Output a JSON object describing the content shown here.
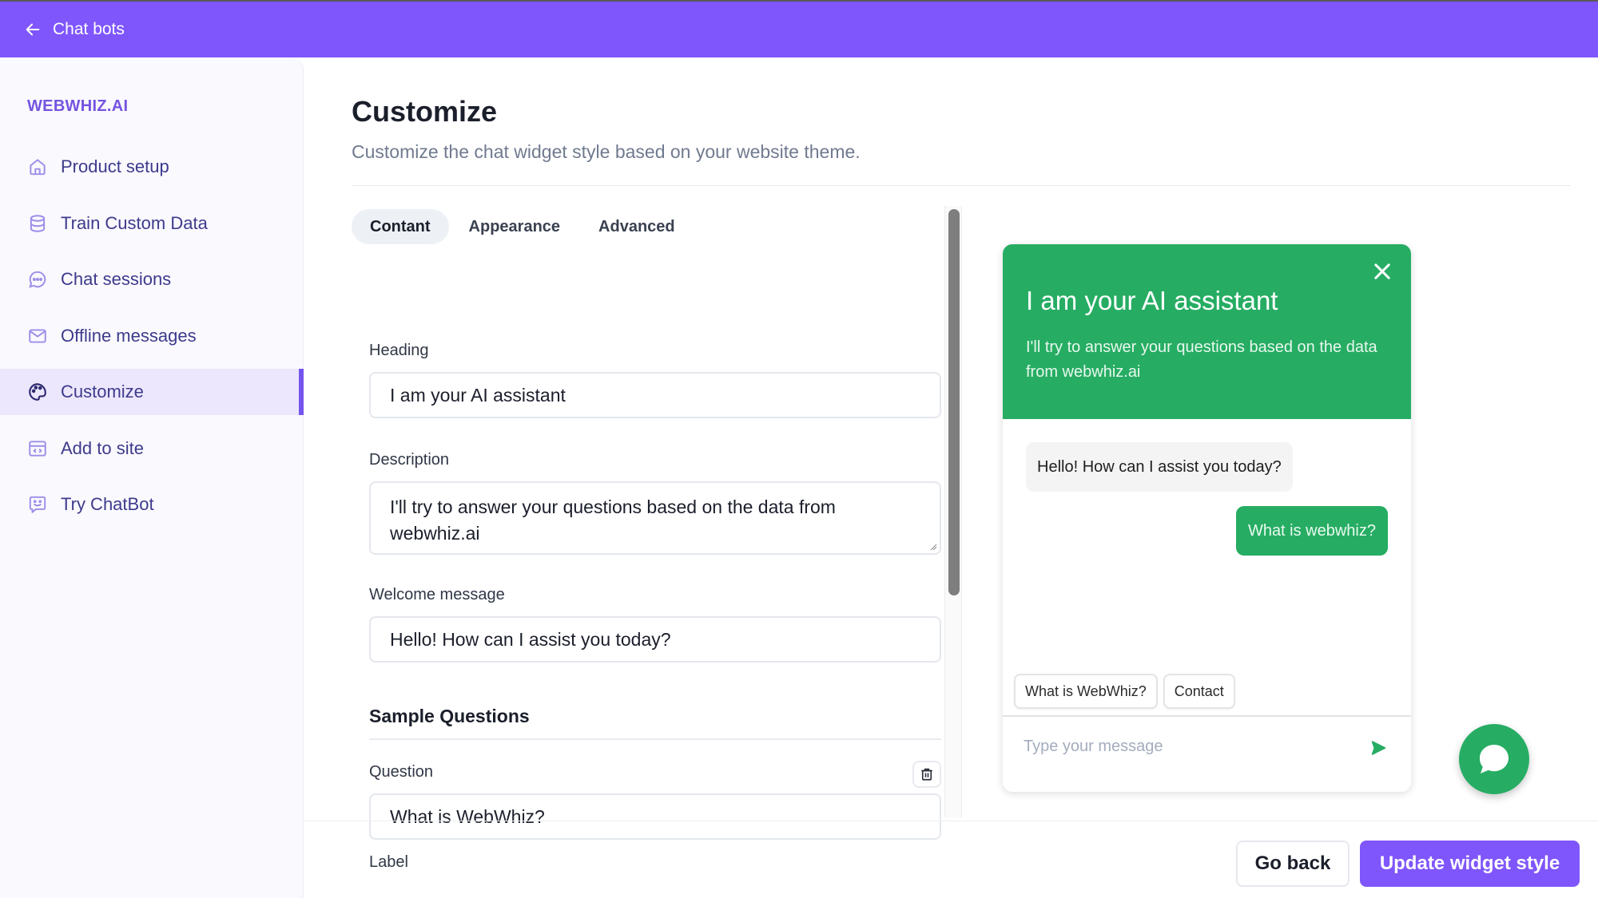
{
  "topbar": {
    "back_label": "Chat bots",
    "back_icon": "arrow-left-icon",
    "color": "#7f56fb"
  },
  "sidebar": {
    "brand": "WEBWHIZ.AI",
    "items": [
      {
        "label": "Product setup",
        "icon": "home-icon",
        "active": false
      },
      {
        "label": "Train Custom Data",
        "icon": "database-icon",
        "active": false
      },
      {
        "label": "Chat sessions",
        "icon": "chat-bubble-icon",
        "active": false
      },
      {
        "label": "Offline messages",
        "icon": "mail-icon",
        "active": false
      },
      {
        "label": "Customize",
        "icon": "palette-icon",
        "active": true
      },
      {
        "label": "Add to site",
        "icon": "code-window-icon",
        "active": false
      },
      {
        "label": "Try ChatBot",
        "icon": "bot-icon",
        "active": false
      }
    ]
  },
  "main": {
    "title": "Customize",
    "subtitle": "Customize the chat widget style based on your website theme.",
    "tabs": [
      {
        "label": "Contant",
        "active": true
      },
      {
        "label": "Appearance",
        "active": false
      },
      {
        "label": "Advanced",
        "active": false
      }
    ],
    "form": {
      "heading_label": "Heading",
      "heading_value": "I am your AI assistant",
      "description_label": "Description",
      "description_value": "I'll try to answer your questions based on the data from webwhiz.ai",
      "welcome_label": "Welcome message",
      "welcome_value": "Hello! How can I assist you today?",
      "sample_section_title": "Sample Questions",
      "question_label": "Question",
      "question_value": "What is WebWhiz?",
      "label_label": "Label"
    }
  },
  "footer": {
    "go_back": "Go back",
    "update": "Update widget style"
  },
  "widget": {
    "accent": "#26ad63",
    "heading": "I am your AI assistant",
    "description": "I'll try to answer your questions based on the data from webwhiz.ai",
    "bot_message": "Hello! How can I assist you today?",
    "user_message": "What is webwhiz?",
    "chips": [
      "What is WebWhiz?",
      "Contact"
    ],
    "input_placeholder": "Type your message"
  }
}
